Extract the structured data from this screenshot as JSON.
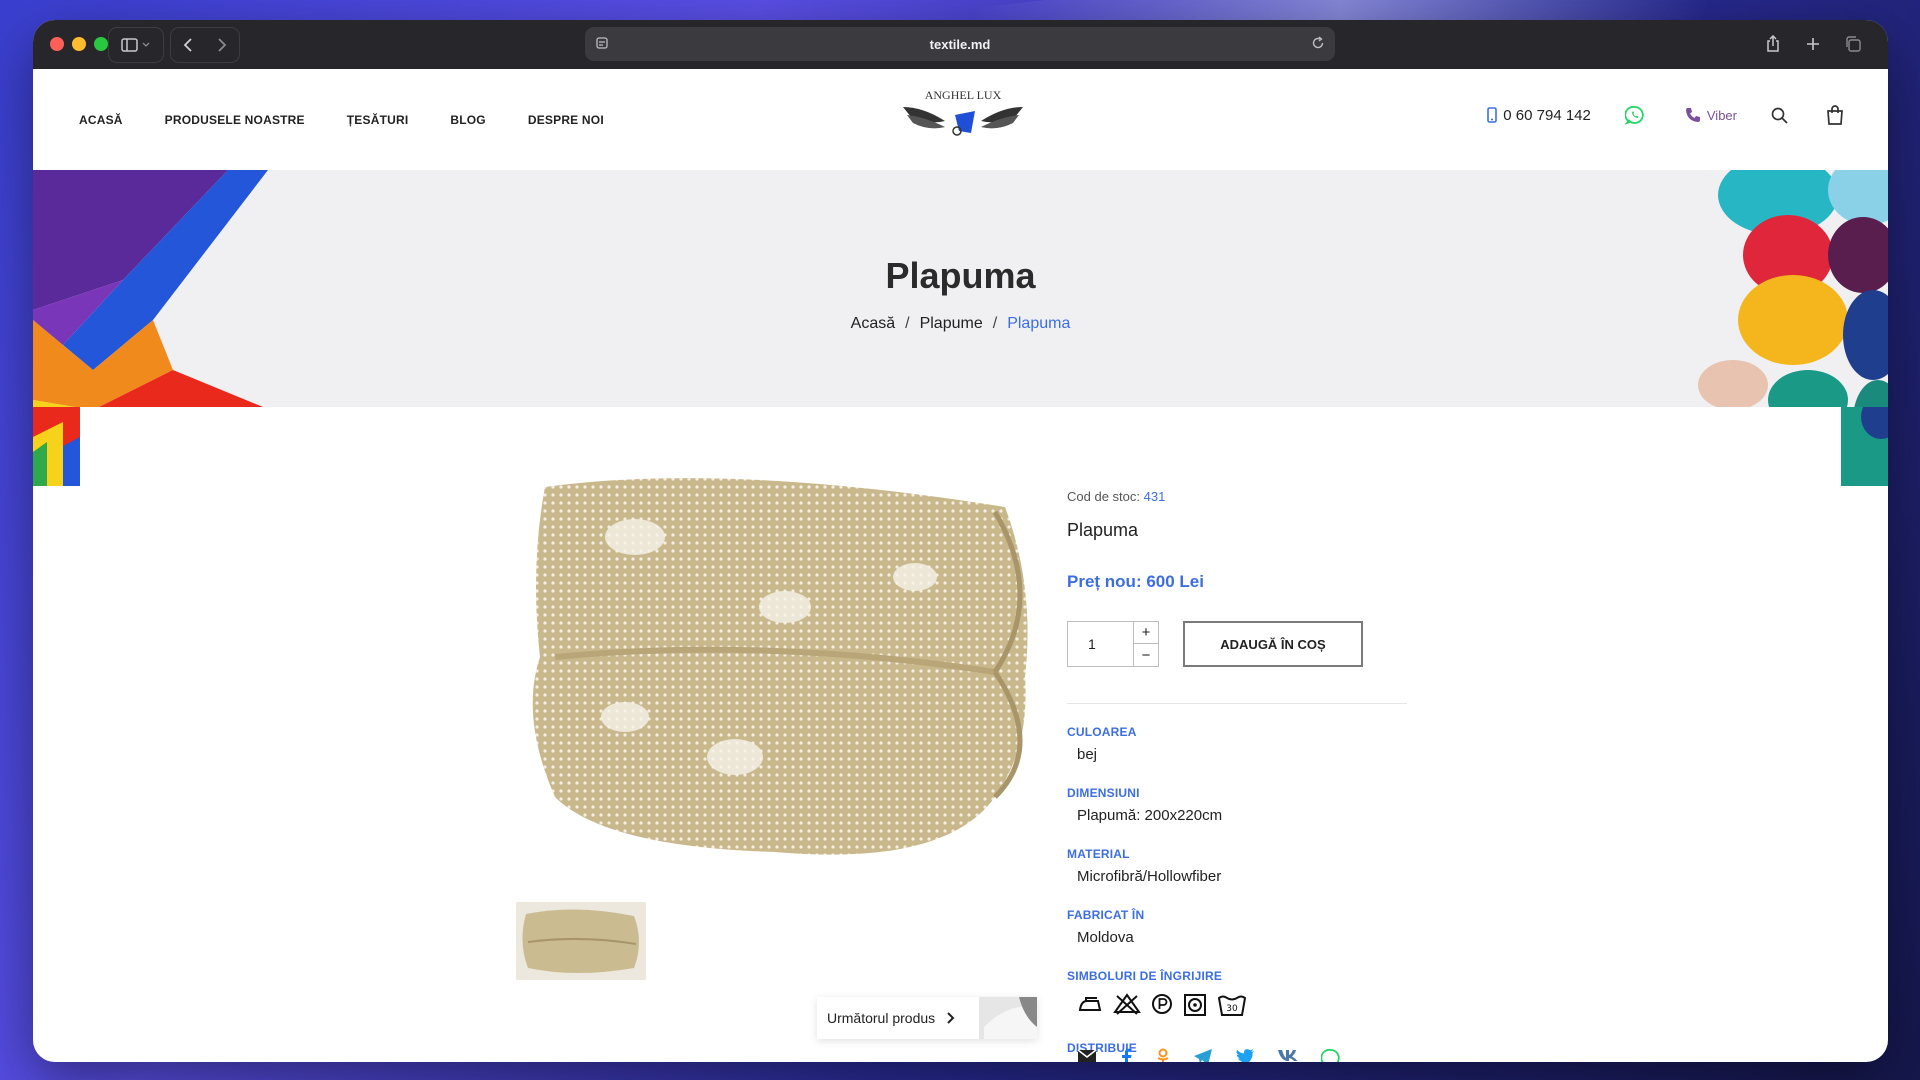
{
  "browser": {
    "url": "textile.md"
  },
  "header": {
    "nav": [
      "ACASĂ",
      "PRODUSELE NOASTRE",
      "ȚESĂTURI",
      "BLOG",
      "DESPRE NOI"
    ],
    "logo_text": "ANGHEL LUX",
    "phone": "0 60 794 142",
    "viber": "Viber"
  },
  "hero": {
    "title": "Plapuma",
    "breadcrumb": [
      "Acasă",
      "Plapume",
      "Plapuma"
    ]
  },
  "product": {
    "sku_label": "Cod de stoc:",
    "sku_value": "431",
    "name": "Plapuma",
    "price": "Preț nou: 600 Lei",
    "quantity": "1",
    "qty_plus": "+",
    "qty_minus": "−",
    "add_to_cart": "ADAUGĂ ÎN COȘ",
    "attributes": [
      {
        "label": "CULOAREA",
        "value": "bej"
      },
      {
        "label": "DIMENSIUNI",
        "value": "Plapumă: 200x220cm"
      },
      {
        "label": "MATERIAL",
        "value": "Microfibră/Hollowfiber"
      },
      {
        "label": "FABRICAT ÎN",
        "value": "Moldova"
      }
    ],
    "care_label": "SIMBOLURI DE ÎNGRIJIRE",
    "care_symbols": [
      "iron-icon",
      "no-bleach-icon",
      "dry-clean-p-icon",
      "tumble-dry-icon",
      "wash-30-icon"
    ],
    "wash_temp": "30",
    "share_label": "DISTRIBUIE",
    "share_icons": [
      "email-icon",
      "facebook-icon",
      "odnoklassniki-icon",
      "telegram-icon",
      "twitter-icon",
      "vk-icon",
      "whatsapp-icon"
    ],
    "next_product": "Următorul produs"
  },
  "colors": {
    "accent": "#3d6ee0",
    "viber": "#7b519d",
    "whatsapp": "#25d366"
  }
}
